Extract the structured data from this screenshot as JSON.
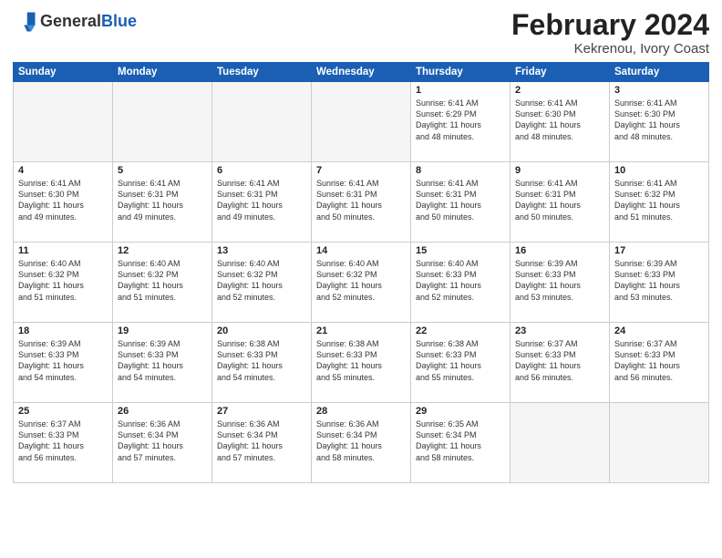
{
  "header": {
    "logo_general": "General",
    "logo_blue": "Blue",
    "main_title": "February 2024",
    "sub_title": "Kekrenou, Ivory Coast"
  },
  "weekdays": [
    "Sunday",
    "Monday",
    "Tuesday",
    "Wednesday",
    "Thursday",
    "Friday",
    "Saturday"
  ],
  "weeks": [
    [
      {
        "day": "",
        "info": ""
      },
      {
        "day": "",
        "info": ""
      },
      {
        "day": "",
        "info": ""
      },
      {
        "day": "",
        "info": ""
      },
      {
        "day": "1",
        "info": "Sunrise: 6:41 AM\nSunset: 6:29 PM\nDaylight: 11 hours\nand 48 minutes."
      },
      {
        "day": "2",
        "info": "Sunrise: 6:41 AM\nSunset: 6:30 PM\nDaylight: 11 hours\nand 48 minutes."
      },
      {
        "day": "3",
        "info": "Sunrise: 6:41 AM\nSunset: 6:30 PM\nDaylight: 11 hours\nand 48 minutes."
      }
    ],
    [
      {
        "day": "4",
        "info": "Sunrise: 6:41 AM\nSunset: 6:30 PM\nDaylight: 11 hours\nand 49 minutes."
      },
      {
        "day": "5",
        "info": "Sunrise: 6:41 AM\nSunset: 6:31 PM\nDaylight: 11 hours\nand 49 minutes."
      },
      {
        "day": "6",
        "info": "Sunrise: 6:41 AM\nSunset: 6:31 PM\nDaylight: 11 hours\nand 49 minutes."
      },
      {
        "day": "7",
        "info": "Sunrise: 6:41 AM\nSunset: 6:31 PM\nDaylight: 11 hours\nand 50 minutes."
      },
      {
        "day": "8",
        "info": "Sunrise: 6:41 AM\nSunset: 6:31 PM\nDaylight: 11 hours\nand 50 minutes."
      },
      {
        "day": "9",
        "info": "Sunrise: 6:41 AM\nSunset: 6:31 PM\nDaylight: 11 hours\nand 50 minutes."
      },
      {
        "day": "10",
        "info": "Sunrise: 6:41 AM\nSunset: 6:32 PM\nDaylight: 11 hours\nand 51 minutes."
      }
    ],
    [
      {
        "day": "11",
        "info": "Sunrise: 6:40 AM\nSunset: 6:32 PM\nDaylight: 11 hours\nand 51 minutes."
      },
      {
        "day": "12",
        "info": "Sunrise: 6:40 AM\nSunset: 6:32 PM\nDaylight: 11 hours\nand 51 minutes."
      },
      {
        "day": "13",
        "info": "Sunrise: 6:40 AM\nSunset: 6:32 PM\nDaylight: 11 hours\nand 52 minutes."
      },
      {
        "day": "14",
        "info": "Sunrise: 6:40 AM\nSunset: 6:32 PM\nDaylight: 11 hours\nand 52 minutes."
      },
      {
        "day": "15",
        "info": "Sunrise: 6:40 AM\nSunset: 6:33 PM\nDaylight: 11 hours\nand 52 minutes."
      },
      {
        "day": "16",
        "info": "Sunrise: 6:39 AM\nSunset: 6:33 PM\nDaylight: 11 hours\nand 53 minutes."
      },
      {
        "day": "17",
        "info": "Sunrise: 6:39 AM\nSunset: 6:33 PM\nDaylight: 11 hours\nand 53 minutes."
      }
    ],
    [
      {
        "day": "18",
        "info": "Sunrise: 6:39 AM\nSunset: 6:33 PM\nDaylight: 11 hours\nand 54 minutes."
      },
      {
        "day": "19",
        "info": "Sunrise: 6:39 AM\nSunset: 6:33 PM\nDaylight: 11 hours\nand 54 minutes."
      },
      {
        "day": "20",
        "info": "Sunrise: 6:38 AM\nSunset: 6:33 PM\nDaylight: 11 hours\nand 54 minutes."
      },
      {
        "day": "21",
        "info": "Sunrise: 6:38 AM\nSunset: 6:33 PM\nDaylight: 11 hours\nand 55 minutes."
      },
      {
        "day": "22",
        "info": "Sunrise: 6:38 AM\nSunset: 6:33 PM\nDaylight: 11 hours\nand 55 minutes."
      },
      {
        "day": "23",
        "info": "Sunrise: 6:37 AM\nSunset: 6:33 PM\nDaylight: 11 hours\nand 56 minutes."
      },
      {
        "day": "24",
        "info": "Sunrise: 6:37 AM\nSunset: 6:33 PM\nDaylight: 11 hours\nand 56 minutes."
      }
    ],
    [
      {
        "day": "25",
        "info": "Sunrise: 6:37 AM\nSunset: 6:33 PM\nDaylight: 11 hours\nand 56 minutes."
      },
      {
        "day": "26",
        "info": "Sunrise: 6:36 AM\nSunset: 6:34 PM\nDaylight: 11 hours\nand 57 minutes."
      },
      {
        "day": "27",
        "info": "Sunrise: 6:36 AM\nSunset: 6:34 PM\nDaylight: 11 hours\nand 57 minutes."
      },
      {
        "day": "28",
        "info": "Sunrise: 6:36 AM\nSunset: 6:34 PM\nDaylight: 11 hours\nand 58 minutes."
      },
      {
        "day": "29",
        "info": "Sunrise: 6:35 AM\nSunset: 6:34 PM\nDaylight: 11 hours\nand 58 minutes."
      },
      {
        "day": "",
        "info": ""
      },
      {
        "day": "",
        "info": ""
      }
    ]
  ]
}
